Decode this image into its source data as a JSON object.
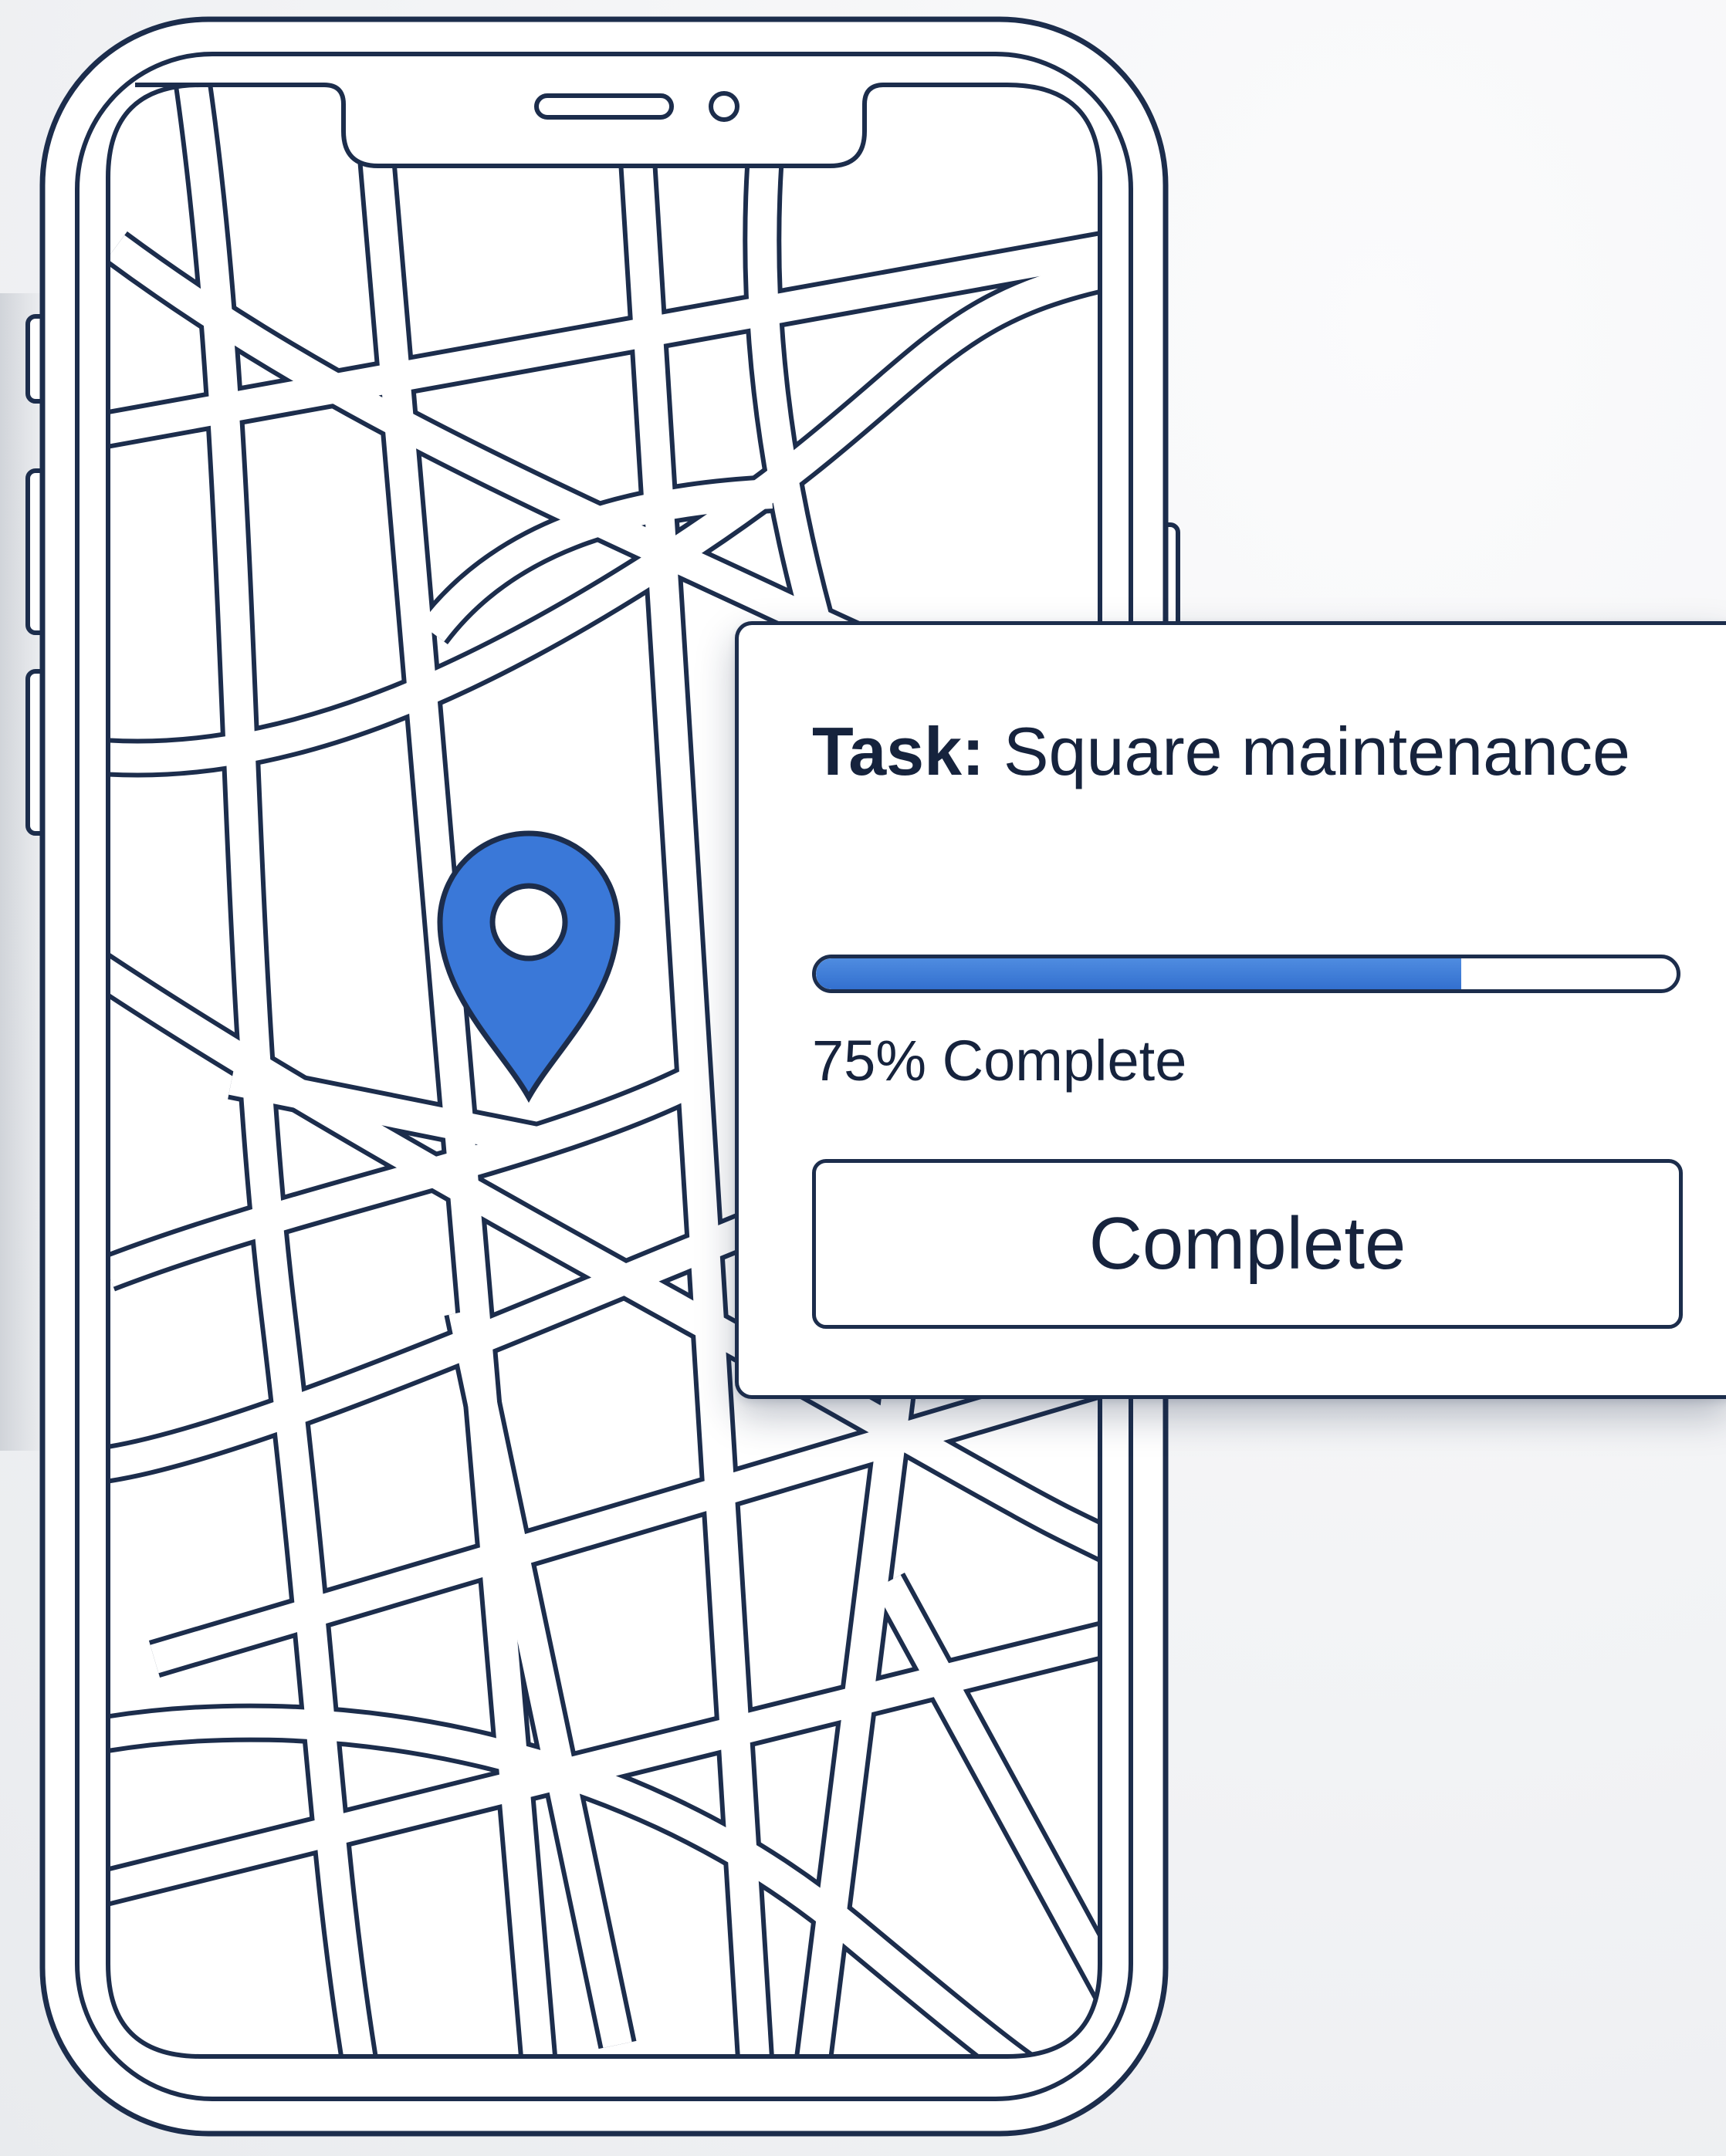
{
  "task_card": {
    "title_key": "Task:",
    "title_value": "Square maintenance",
    "progress_value": 0.75,
    "progress_label": "75% Complete",
    "button_label": "Complete"
  },
  "colors": {
    "ink": "#1c2d4c",
    "accent": "#3a78d8",
    "card_bg": "#ffffff",
    "page_bg": "#f3f4f6"
  },
  "icons": [
    "location-pin-icon"
  ]
}
